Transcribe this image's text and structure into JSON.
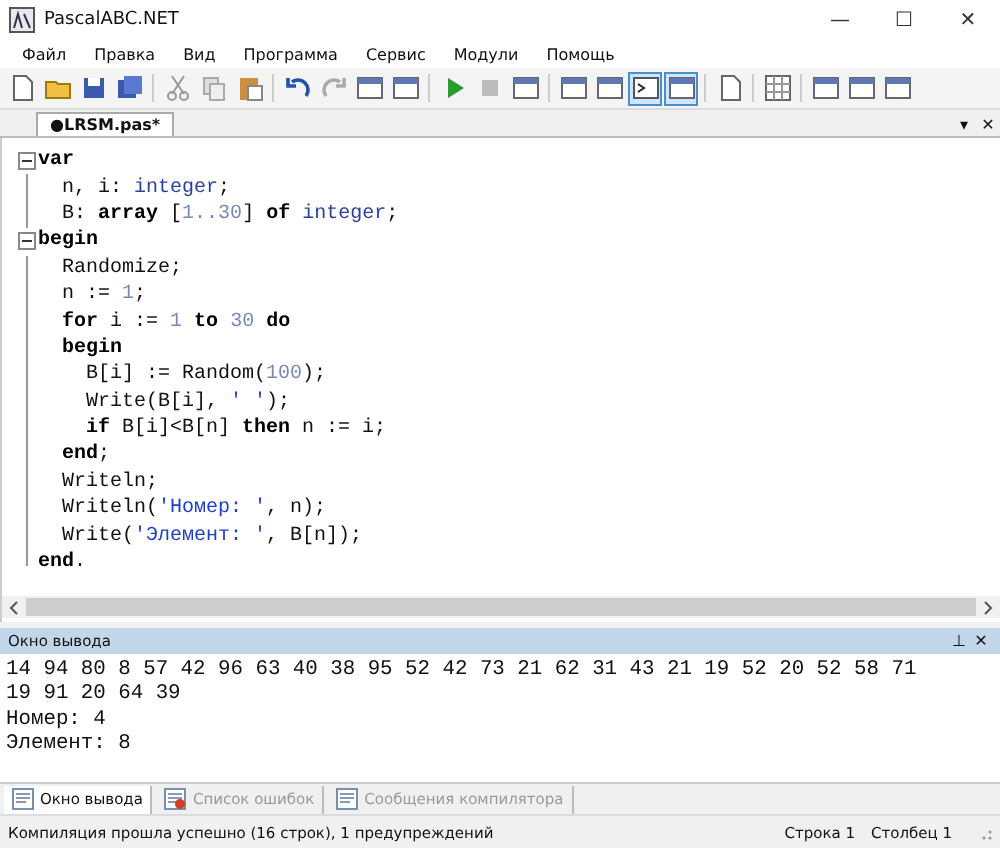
{
  "window": {
    "title": "PascalABC.NET",
    "controls": [
      "—",
      "☐",
      "✕"
    ]
  },
  "menu": [
    "Файл",
    "Правка",
    "Вид",
    "Программа",
    "Сервис",
    "Модули",
    "Помощь"
  ],
  "toolbar": {
    "toggles": [
      {
        "on": true
      },
      {
        "on": true
      }
    ]
  },
  "editor_tab": {
    "label": "●LRSM.pas*",
    "menu_glyph": "▾",
    "close_glyph": "✕"
  },
  "code_lines": [
    {
      "kind": "fold_start",
      "tokens": [
        {
          "kind": "kw",
          "text": "var"
        }
      ]
    },
    {
      "kind": "fold_body",
      "tokens": [
        {
          "kind": "plain",
          "text": "  n, i: "
        },
        {
          "kind": "type",
          "text": "integer"
        },
        {
          "kind": "plain",
          "text": ";"
        }
      ]
    },
    {
      "kind": "fold_body",
      "tokens": [
        {
          "kind": "plain",
          "text": "  B: "
        },
        {
          "kind": "kw",
          "text": "array"
        },
        {
          "kind": "plain",
          "text": " ["
        },
        {
          "kind": "num",
          "text": "1..30"
        },
        {
          "kind": "plain",
          "text": "] "
        },
        {
          "kind": "kw",
          "text": "of"
        },
        {
          "kind": "type",
          "text": " integer"
        },
        {
          "kind": "plain",
          "text": ";"
        }
      ]
    },
    {
      "kind": "fold_start",
      "tokens": [
        {
          "kind": "kw",
          "text": "begin"
        }
      ]
    },
    {
      "kind": "fold_body",
      "tokens": [
        {
          "kind": "plain",
          "text": "  Randomize;"
        }
      ]
    },
    {
      "kind": "fold_body",
      "tokens": [
        {
          "kind": "plain",
          "text": "  n := "
        },
        {
          "kind": "num",
          "text": "1"
        },
        {
          "kind": "plain",
          "text": ";"
        }
      ]
    },
    {
      "kind": "fold_body",
      "tokens": [
        {
          "kind": "kw",
          "text": "  for"
        },
        {
          "kind": "plain",
          "text": " i := "
        },
        {
          "kind": "num",
          "text": "1"
        },
        {
          "kind": "kw",
          "text": " to"
        },
        {
          "kind": "num",
          "text": " 30"
        },
        {
          "kind": "kw",
          "text": " do"
        }
      ]
    },
    {
      "kind": "fold_body",
      "tokens": [
        {
          "kind": "kw",
          "text": "  begin"
        }
      ]
    },
    {
      "kind": "fold_body",
      "tokens": [
        {
          "kind": "plain",
          "text": "    B[i] := Random("
        },
        {
          "kind": "num",
          "text": "100"
        },
        {
          "kind": "plain",
          "text": ");"
        }
      ]
    },
    {
      "kind": "fold_body",
      "tokens": [
        {
          "kind": "plain",
          "text": "    Write(B[i], "
        },
        {
          "kind": "str",
          "text": "' '"
        },
        {
          "kind": "plain",
          "text": ");"
        }
      ]
    },
    {
      "kind": "fold_body",
      "tokens": [
        {
          "kind": "kw",
          "text": "    if"
        },
        {
          "kind": "plain",
          "text": " B[i]<B[n] "
        },
        {
          "kind": "kw",
          "text": "then"
        },
        {
          "kind": "plain",
          "text": " n := i;"
        }
      ]
    },
    {
      "kind": "fold_body",
      "tokens": [
        {
          "kind": "kw",
          "text": "  end"
        },
        {
          "kind": "plain",
          "text": ";"
        }
      ]
    },
    {
      "kind": "fold_body",
      "tokens": [
        {
          "kind": "plain",
          "text": "  Writeln;"
        }
      ]
    },
    {
      "kind": "fold_body",
      "tokens": [
        {
          "kind": "plain",
          "text": "  Writeln("
        },
        {
          "kind": "str",
          "text": "'Номер: '"
        },
        {
          "kind": "plain",
          "text": ", n);"
        }
      ]
    },
    {
      "kind": "fold_body",
      "tokens": [
        {
          "kind": "plain",
          "text": "  Write("
        },
        {
          "kind": "str",
          "text": "'Элемент: '"
        },
        {
          "kind": "plain",
          "text": ", B[n]);"
        }
      ]
    },
    {
      "kind": "fold_end",
      "tokens": [
        {
          "kind": "kw",
          "text": "end"
        },
        {
          "kind": "plain",
          "text": "."
        }
      ]
    }
  ],
  "output_panel": {
    "title": "Окно вывода",
    "pin_glyph": "⊥",
    "close_glyph": "✕",
    "lines": [
      "14 94 80 8 57 42 96 63 40 38 95 52 42 73 21 62 31 43 21 19 52 20 52 58 71",
      "19 91 20 64 39",
      "Номер: 4",
      "Элемент: 8"
    ]
  },
  "bottom_tabs": [
    {
      "label": "Окно вывода",
      "selected": true
    },
    {
      "label": "Список ошибок",
      "selected": false
    },
    {
      "label": "Сообщения компилятора",
      "selected": false
    }
  ],
  "status_bar": {
    "message": "Компиляция прошла успешно (16 строк), 1 предупреждений",
    "row": "Строка  1",
    "column": "Столбец  1"
  }
}
